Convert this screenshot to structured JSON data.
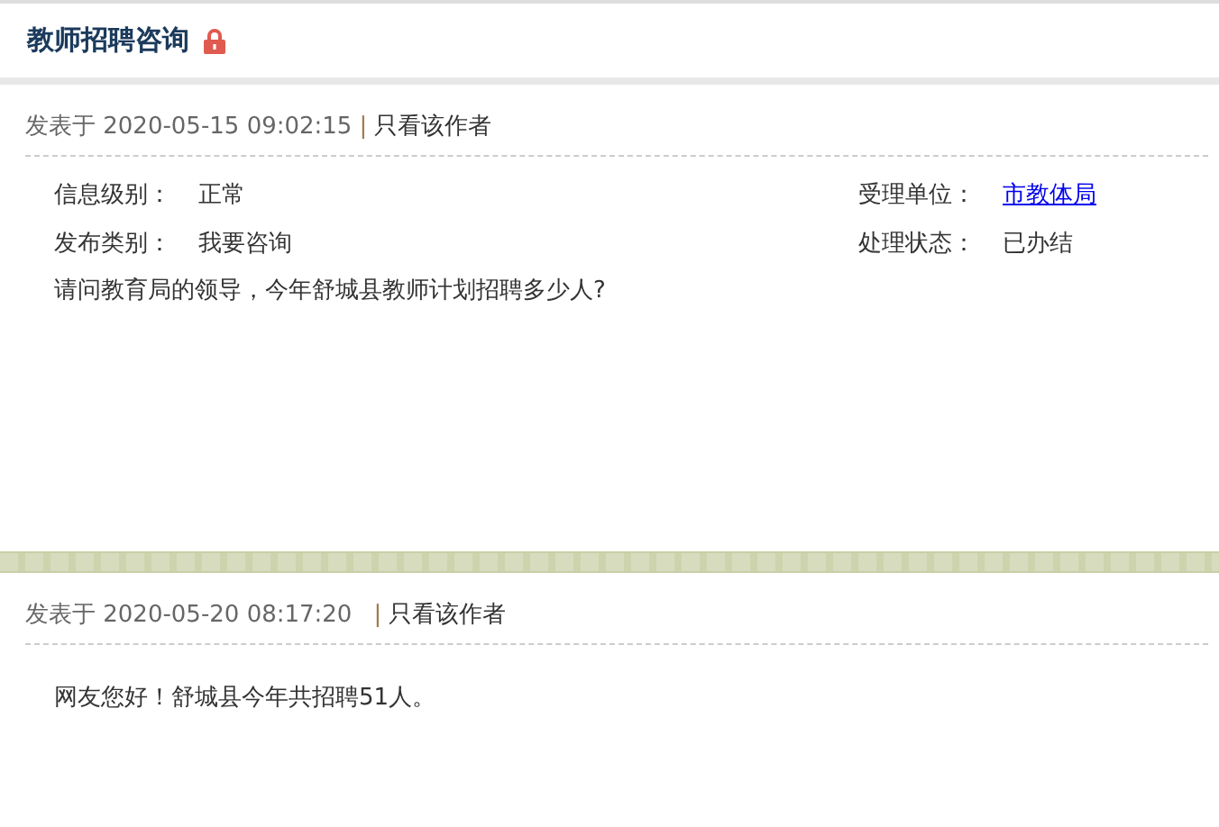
{
  "title": "教师招聘咨询",
  "locked": true,
  "posts": [
    {
      "posted": "发表于 2020-05-15 09:02:15",
      "separator": "|",
      "author_only": "只看该作者",
      "fields": [
        {
          "label": "信息级别：",
          "value": "正常",
          "kind": "text"
        },
        {
          "label": "受理单位：",
          "value": "市教体局",
          "kind": "link"
        },
        {
          "label": "发布类别：",
          "value": "我要咨询",
          "kind": "text"
        },
        {
          "label": "处理状态：",
          "value": "已办结",
          "kind": "text"
        }
      ],
      "body": "请问教育局的领导，今年舒城县教师计划招聘多少人?"
    },
    {
      "posted": "发表于 2020-05-20 08:17:20",
      "separator": "|",
      "author_only": "只看该作者",
      "body": "网友您好！舒城县今年共招聘51人。"
    }
  ]
}
